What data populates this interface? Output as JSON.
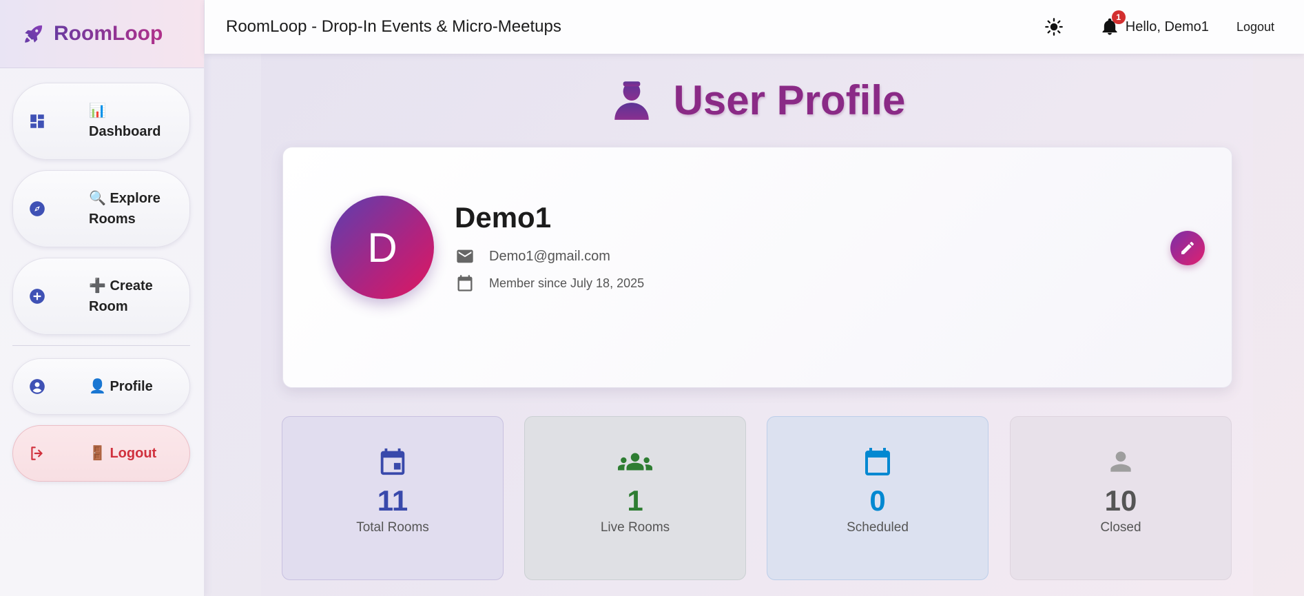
{
  "brand": {
    "name": "RoomLoop"
  },
  "sidebar": {
    "items": [
      {
        "emoji": "📊",
        "label": "Dashboard"
      },
      {
        "emoji": "🔍",
        "label": "Explore\nRooms"
      },
      {
        "emoji": "➕",
        "label": "Create\nRoom"
      },
      {
        "emoji": "👤",
        "label": "Profile"
      },
      {
        "emoji": "🚪",
        "label": "Logout"
      }
    ]
  },
  "topbar": {
    "title": "RoomLoop - Drop-In Events & Micro-Meetups",
    "notification_count": "1",
    "greeting": "Hello, Demo1",
    "logout_label": "Logout"
  },
  "page": {
    "heading": "User Profile"
  },
  "profile": {
    "initial": "D",
    "name": "Demo1",
    "email": "Demo1@gmail.com",
    "member_since": "Member since July 18, 2025"
  },
  "stats": {
    "total": {
      "value": "11",
      "label": "Total Rooms",
      "color": "#3949ab"
    },
    "live": {
      "value": "1",
      "label": "Live Rooms",
      "color": "#2e7d32"
    },
    "scheduled": {
      "value": "0",
      "label": "Scheduled",
      "color": "#0288d1"
    },
    "closed": {
      "value": "10",
      "label": "Closed",
      "color": "#555555"
    }
  }
}
